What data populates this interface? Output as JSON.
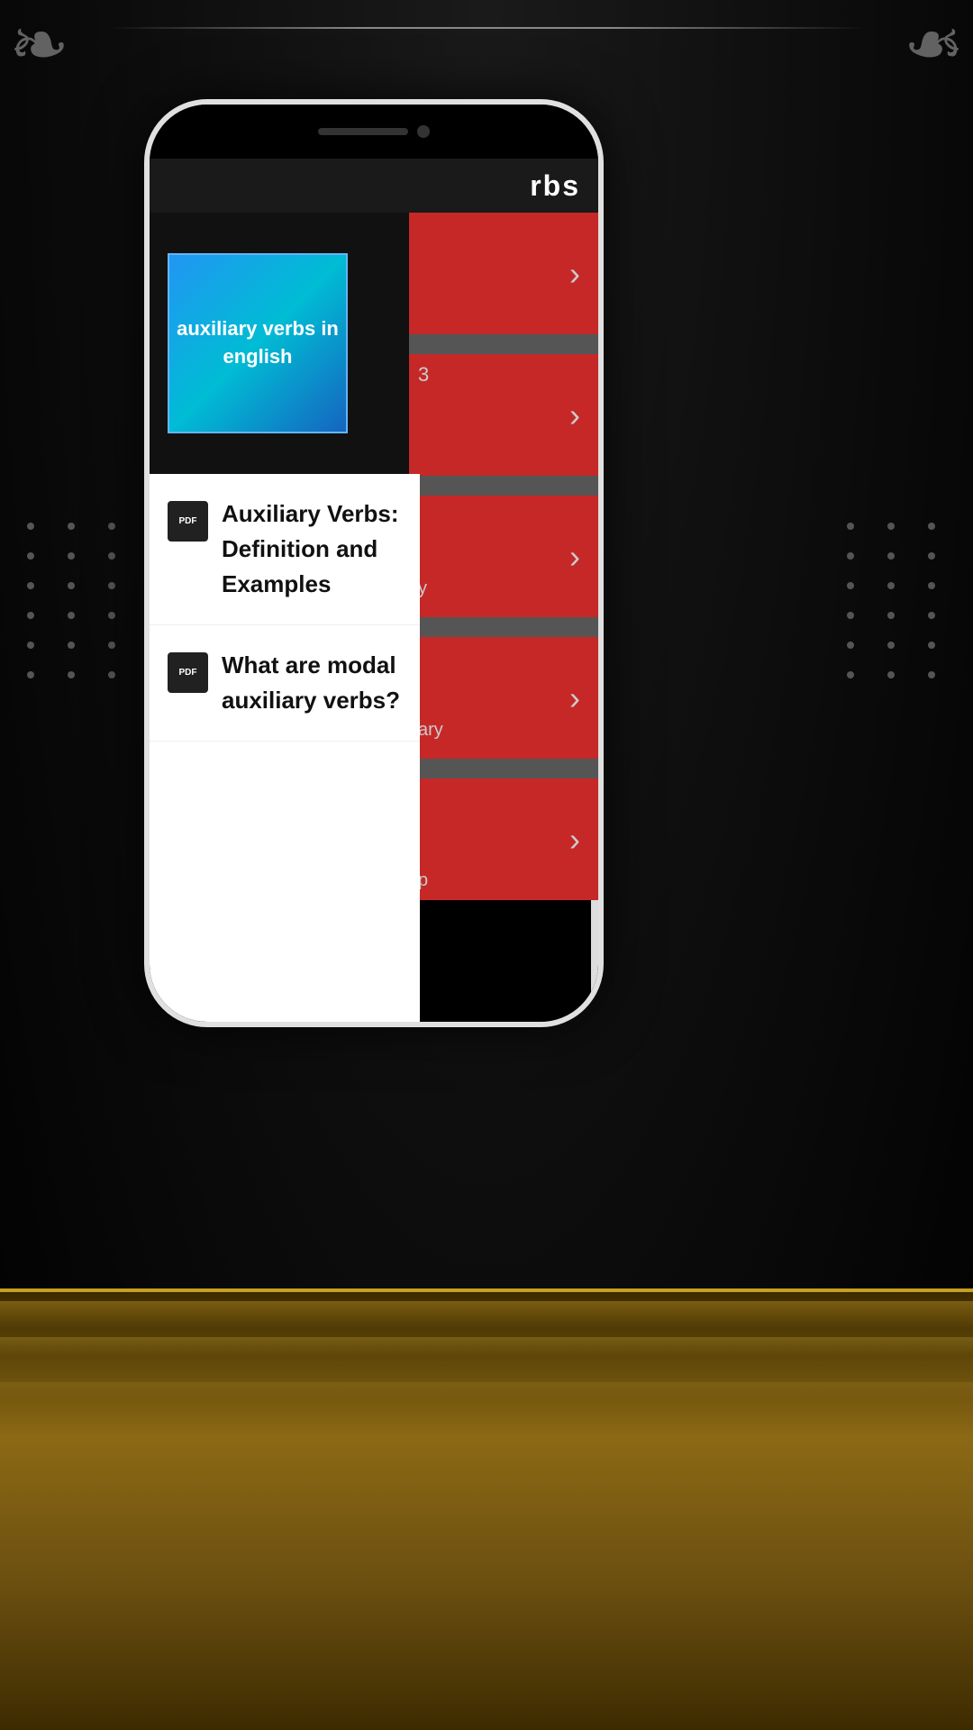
{
  "app": {
    "header_partial": "rbs",
    "background_color": "#000"
  },
  "thumbnail": {
    "text": "auxiliary verbs in english",
    "bg_color_start": "#2196F3",
    "bg_color_end": "#1565C0"
  },
  "menu_items": [
    {
      "id": "item1",
      "icon": "PDF",
      "title": "Auxiliary Verbs: Definition and Examples"
    },
    {
      "id": "item2",
      "icon": "PDF",
      "title": "What are modal auxiliary verbs?"
    }
  ],
  "decorations": {
    "corner_ornament": "❧",
    "dots": "•"
  }
}
